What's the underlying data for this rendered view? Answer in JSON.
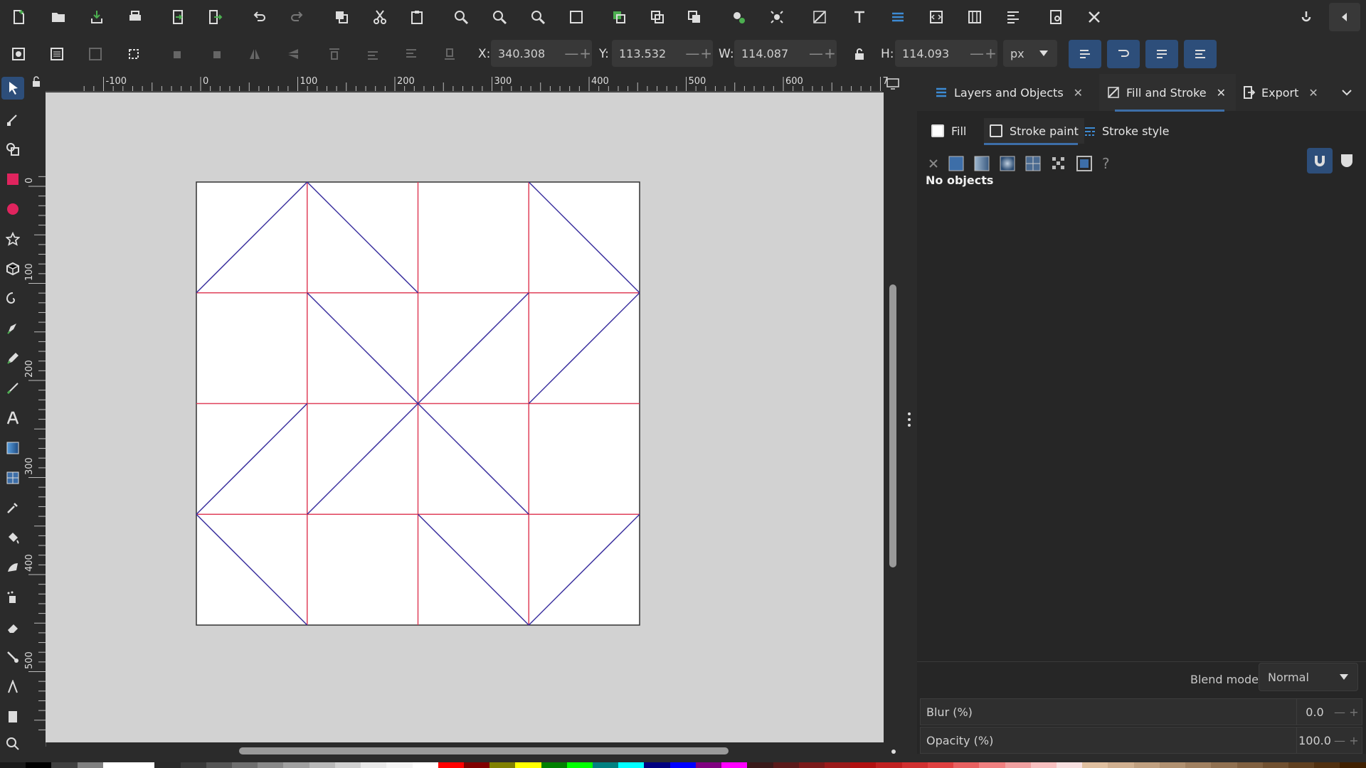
{
  "toolbar": {
    "x_label": "X:",
    "x_value": "340.308",
    "y_label": "Y:",
    "y_value": "113.532",
    "w_label": "W:",
    "w_value": "114.087",
    "h_label": "H:",
    "h_value": "114.093",
    "unit": "px",
    "minus": "—",
    "plus": "+"
  },
  "rulers": {
    "horizontal": [
      "-100",
      "0",
      "100",
      "200",
      "300",
      "400",
      "500",
      "600",
      "7"
    ],
    "vertical": [
      "0",
      "100",
      "200",
      "300",
      "400",
      "500"
    ]
  },
  "panel": {
    "tabs": [
      {
        "label": "Layers and Objects"
      },
      {
        "label": "Fill and Stroke"
      },
      {
        "label": "Export"
      }
    ],
    "subtabs": [
      {
        "label": "Fill"
      },
      {
        "label": "Stroke paint"
      },
      {
        "label": "Stroke style"
      }
    ],
    "status": "No objects",
    "paint_help": "?",
    "blend_label": "Blend mode:",
    "blend_value": "Normal",
    "blur_label": "Blur (%)",
    "blur_value": "0.0",
    "opacity_label": "Opacity (%)",
    "opacity_value": "100.0",
    "minus": "—",
    "plus": "+",
    "close": "✕"
  },
  "colors": {
    "grid_line": "#e0405a",
    "diagonal_line": "#3a2f9e",
    "accent": "#3d6ea8"
  },
  "palette": [
    "#1a1a1a",
    "#000000",
    "#404040",
    "#808080",
    "#ffffff",
    "#ffffff",
    "#2a2a2a",
    "#3a3a3a",
    "#555555",
    "#6e6e6e",
    "#888888",
    "#a0a0a0",
    "#b8b8b8",
    "#d0d0d0",
    "#e8e8e8",
    "#f4f4f4",
    "#ffffff",
    "#ff0000",
    "#800000",
    "#808000",
    "#ffff00",
    "#008000",
    "#00ff00",
    "#008080",
    "#00ffff",
    "#000080",
    "#0000ff",
    "#800080",
    "#ff00ff",
    "#3a1a1a",
    "#5a1a1a",
    "#7a1a1a",
    "#9a1a1a",
    "#b01010",
    "#c02020",
    "#d03030",
    "#e04040",
    "#e86060",
    "#f08080",
    "#f0a0a0",
    "#f8c0c0",
    "#f8e0e0",
    "#e0c0a0",
    "#d0b090",
    "#c0a080",
    "#b09070",
    "#a08060",
    "#907050",
    "#806040",
    "#705030",
    "#604020",
    "#503010",
    "#402000"
  ]
}
